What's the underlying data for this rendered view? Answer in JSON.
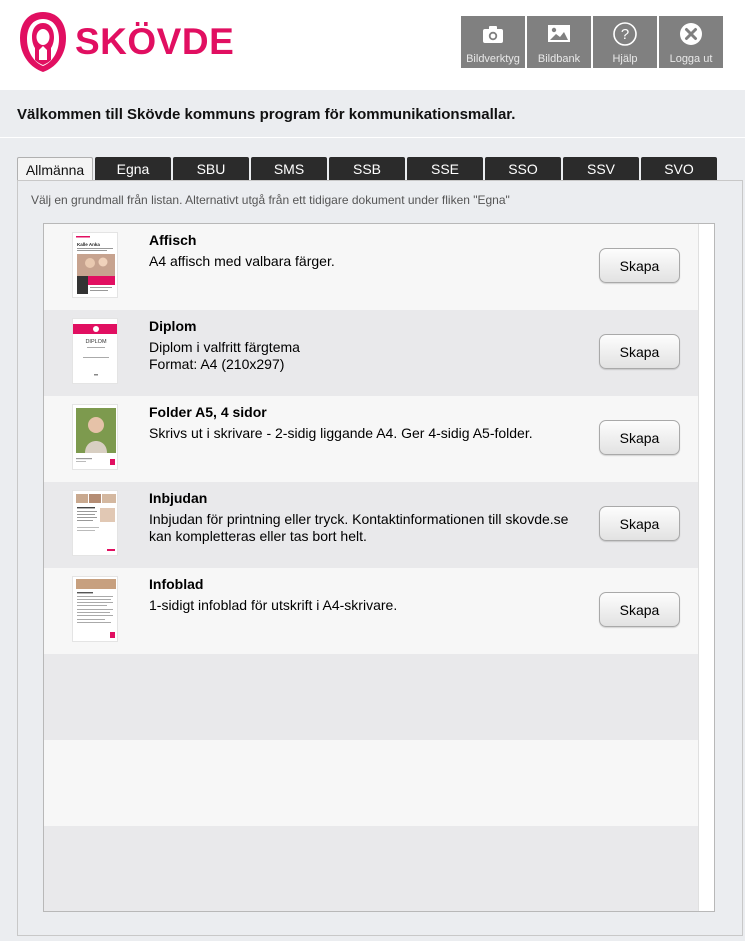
{
  "header": {
    "logo_text": "SKÖVDE",
    "brand_color": "#e10f61",
    "toolbar": [
      {
        "label": "Bildverktyg",
        "icon": "camera-icon"
      },
      {
        "label": "Bildbank",
        "icon": "image-icon"
      },
      {
        "label": "Hjälp",
        "icon": "help-icon"
      },
      {
        "label": "Logga ut",
        "icon": "close-circle-icon"
      }
    ]
  },
  "welcome": "Välkommen till Skövde kommuns program för kommunikationsmallar.",
  "tabs": [
    {
      "label": "Allmänna",
      "active": true
    },
    {
      "label": "Egna"
    },
    {
      "label": "SBU"
    },
    {
      "label": "SMS"
    },
    {
      "label": "SSB"
    },
    {
      "label": "SSE"
    },
    {
      "label": "SSO"
    },
    {
      "label": "SSV"
    },
    {
      "label": "SVO"
    }
  ],
  "hint": "Välj en grundmall från listan. Alternativt utgå från ett tidigare dokument under fliken \"Egna\"",
  "templates": [
    {
      "title": "Affisch",
      "desc1": "A4 affisch med valbara färger.",
      "desc2": "",
      "button": "Skapa"
    },
    {
      "title": "Diplom",
      "desc1": "Diplom i valfritt färgtema",
      "desc2": "Format: A4 (210x297)",
      "button": "Skapa"
    },
    {
      "title": "Folder A5, 4 sidor",
      "desc1": "Skrivs ut i skrivare - 2-sidig liggande A4. Ger 4-sidig A5-folder.",
      "desc2": "",
      "button": "Skapa"
    },
    {
      "title": "Inbjudan",
      "desc1": "Inbjudan för printning eller tryck. Kontaktinformationen till skovde.se",
      "desc2": "kan kompletteras eller tas bort helt.",
      "button": "Skapa"
    },
    {
      "title": "Infoblad",
      "desc1": "1-sidigt infoblad för utskrift i A4-skrivare.",
      "desc2": "",
      "button": "Skapa"
    }
  ],
  "thumbs": {
    "affisch_name": "Kalle Anka",
    "diplom_label": "DIPLOM"
  }
}
